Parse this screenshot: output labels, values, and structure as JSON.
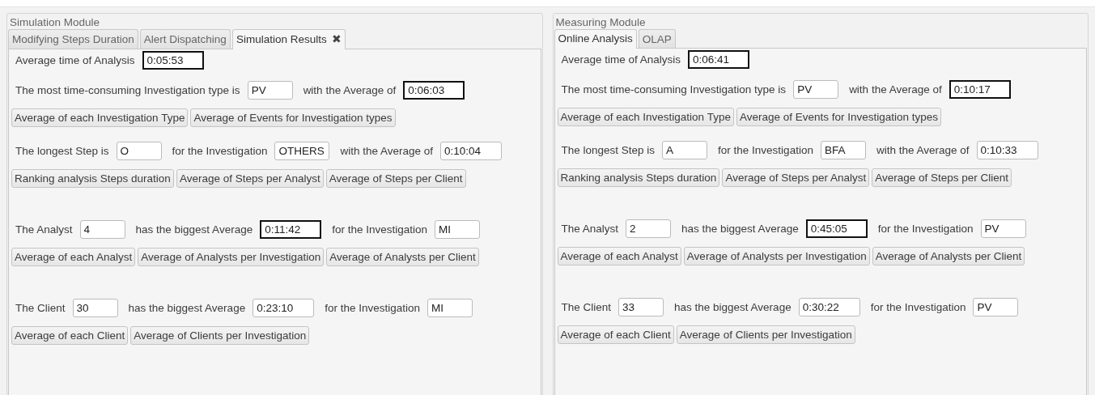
{
  "panels": [
    {
      "title": "Simulation Module",
      "tabs": [
        {
          "label": "Modifying Steps Duration",
          "selected": false
        },
        {
          "label": "Alert Dispatching",
          "selected": false
        },
        {
          "label": "Simulation Results",
          "selected": true,
          "close": "✖"
        }
      ],
      "groups": [
        [
          {
            "kind": "line",
            "items": [
              {
                "text": "Average time of Analysis"
              },
              {
                "field": "0:05:53",
                "highlighted": true
              }
            ]
          },
          {
            "kind": "line",
            "items": [
              {
                "text": "The most time-consuming Investigation type is"
              },
              {
                "field": "PV",
                "highlighted": false
              },
              {
                "text": "with the Average of"
              },
              {
                "field": "0:06:03",
                "highlighted": true
              }
            ]
          },
          {
            "kind": "buttons",
            "buttons": [
              "Average of each Investigation Type",
              "Average of Events for Investigation types"
            ]
          }
        ],
        [
          {
            "kind": "line",
            "items": [
              {
                "text": "The longest Step is"
              },
              {
                "field": "O",
                "highlighted": false
              },
              {
                "text": "for the Investigation"
              },
              {
                "field": "OTHERS",
                "highlighted": false
              },
              {
                "text": "with the Average of"
              },
              {
                "field": "0:10:04",
                "highlighted": false
              }
            ]
          },
          {
            "kind": "buttons",
            "buttons": [
              "Ranking analysis Steps duration",
              "Average of Steps per Analyst",
              "Average of Steps per Client"
            ]
          }
        ],
        [
          {
            "kind": "line",
            "items": [
              {
                "text": "The Analyst"
              },
              {
                "field": "4",
                "highlighted": false
              },
              {
                "text": "has the biggest Average"
              },
              {
                "field": "0:11:42",
                "highlighted": true
              },
              {
                "text": "for the Investigation"
              },
              {
                "field": "MI",
                "highlighted": false
              }
            ]
          },
          {
            "kind": "buttons",
            "buttons": [
              "Average of each Analyst",
              "Average of Analysts per Investigation",
              "Average of Analysts per Client"
            ]
          }
        ],
        [
          {
            "kind": "line",
            "items": [
              {
                "text": "The Client"
              },
              {
                "field": "30",
                "highlighted": false
              },
              {
                "text": "has the biggest Average"
              },
              {
                "field": "0:23:10",
                "highlighted": false
              },
              {
                "text": "for the Investigation"
              },
              {
                "field": "MI",
                "highlighted": false
              }
            ]
          },
          {
            "kind": "buttons",
            "buttons": [
              "Average of each Client",
              "Average of Clients per Investigation"
            ]
          }
        ]
      ]
    },
    {
      "title": "Measuring Module",
      "tabs": [
        {
          "label": "Online Analysis",
          "selected": true
        },
        {
          "label": "OLAP",
          "selected": false
        }
      ],
      "groups": [
        [
          {
            "kind": "line",
            "items": [
              {
                "text": "Average time of Analysis"
              },
              {
                "field": "0:06:41",
                "highlighted": true
              }
            ]
          },
          {
            "kind": "line",
            "items": [
              {
                "text": "The most time-consuming Investigation type is"
              },
              {
                "field": "PV",
                "highlighted": false
              },
              {
                "text": "with the Average of"
              },
              {
                "field": "0:10:17",
                "highlighted": true
              }
            ]
          },
          {
            "kind": "buttons",
            "buttons": [
              "Average of each Investigation Type",
              "Average of Events for Investigation types"
            ]
          }
        ],
        [
          {
            "kind": "line",
            "items": [
              {
                "text": "The longest Step is"
              },
              {
                "field": "A",
                "highlighted": false
              },
              {
                "text": "for the Investigation"
              },
              {
                "field": "BFA",
                "highlighted": false
              },
              {
                "text": "with the Average of"
              },
              {
                "field": "0:10:33",
                "highlighted": false
              }
            ]
          },
          {
            "kind": "buttons",
            "buttons": [
              "Ranking analysis Steps duration",
              "Average of Steps per Analyst",
              "Average of Steps per Client"
            ]
          }
        ],
        [
          {
            "kind": "line",
            "items": [
              {
                "text": "The Analyst"
              },
              {
                "field": "2",
                "highlighted": false
              },
              {
                "text": "has the biggest Average"
              },
              {
                "field": "0:45:05",
                "highlighted": true
              },
              {
                "text": "for the Investigation"
              },
              {
                "field": "PV",
                "highlighted": false
              }
            ]
          },
          {
            "kind": "buttons",
            "buttons": [
              "Average of each Analyst",
              "Average of Analysts per Investigation",
              "Average of Analysts per Client"
            ]
          }
        ],
        [
          {
            "kind": "line",
            "items": [
              {
                "text": "The Client"
              },
              {
                "field": "33",
                "highlighted": false
              },
              {
                "text": "has the biggest Average"
              },
              {
                "field": "0:30:22",
                "highlighted": false
              },
              {
                "text": "for the Investigation"
              },
              {
                "field": "PV",
                "highlighted": false
              }
            ]
          },
          {
            "kind": "buttons",
            "buttons": [
              "Average of each Client",
              "Average of Clients per Investigation"
            ]
          }
        ]
      ]
    }
  ]
}
